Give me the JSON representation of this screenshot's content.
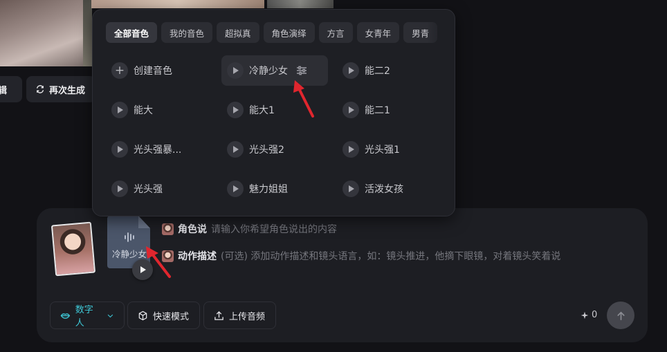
{
  "top_actions": {
    "edit_label": "编辑",
    "regenerate_label": "再次生成"
  },
  "voice_popup": {
    "tabs": [
      {
        "label": "全部音色",
        "active": true
      },
      {
        "label": "我的音色",
        "active": false
      },
      {
        "label": "超拟真",
        "active": false
      },
      {
        "label": "角色演绎",
        "active": false
      },
      {
        "label": "方言",
        "active": false
      },
      {
        "label": "女青年",
        "active": false
      },
      {
        "label": "男青",
        "active": false
      }
    ],
    "create_label": "创建音色",
    "voices": [
      {
        "label": "冷静少女",
        "selected": true
      },
      {
        "label": "能二2"
      },
      {
        "label": "能大"
      },
      {
        "label": "能大1"
      },
      {
        "label": "能二1"
      },
      {
        "label": "光头强暴..."
      },
      {
        "label": "光头强2"
      },
      {
        "label": "光头强1"
      },
      {
        "label": "光头强"
      },
      {
        "label": "魅力姐姐"
      },
      {
        "label": "活泼女孩"
      }
    ]
  },
  "composer": {
    "audio_file_label": "冷静少女",
    "speech_label": "角色说",
    "speech_placeholder": "请输入你希望角色说出的内容",
    "action_label": "动作描述",
    "action_placeholder": "(可选) 添加动作描述和镜头语言，如：镜头推进，他摘下眼镜，对着镜头笑着说",
    "mode_button": "数字人",
    "fast_mode_button": "快速模式",
    "upload_button": "上传音频",
    "credit_count": "0",
    "accent_color": "#3ec9d8",
    "annotation_color": "#e0262e"
  }
}
